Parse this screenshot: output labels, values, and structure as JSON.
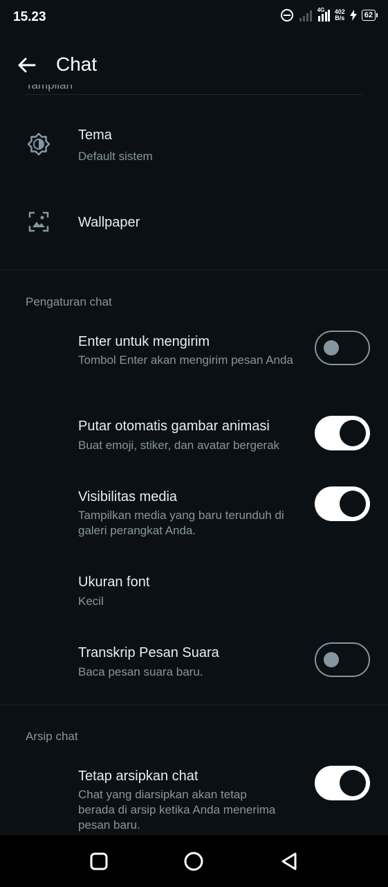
{
  "status_bar": {
    "time": "15.23",
    "net_speed_value": "402",
    "net_speed_unit": "B/s",
    "network_type": "4G",
    "battery": "62"
  },
  "app_bar": {
    "title": "Chat"
  },
  "display_section": {
    "header_clipped": "Tampilan",
    "items": [
      {
        "title": "Tema",
        "subtitle": "Default sistem",
        "icon": "brightness-icon"
      },
      {
        "title": "Wallpaper",
        "icon": "wallpaper-icon"
      }
    ]
  },
  "chat_settings": {
    "header": "Pengaturan chat",
    "items": [
      {
        "title": "Enter untuk mengirim",
        "subtitle": "Tombol Enter akan mengirim pesan Anda",
        "toggle": false
      },
      {
        "title": "Putar otomatis gambar animasi",
        "subtitle": "Buat emoji, stiker, dan avatar bergerak",
        "toggle": true
      },
      {
        "title": "Visibilitas media",
        "subtitle": "Tampilkan media yang baru terunduh di galeri perangkat Anda.",
        "toggle": true
      },
      {
        "title": "Ukuran font",
        "subtitle": "Kecil"
      },
      {
        "title": "Transkrip Pesan Suara",
        "subtitle": "Baca pesan suara baru.",
        "toggle": false
      }
    ]
  },
  "archive_section": {
    "header": "Arsip chat",
    "items": [
      {
        "title": "Tetap arsipkan chat",
        "subtitle": "Chat yang diarsipkan akan tetap berada di arsip ketika Anda menerima pesan baru.",
        "toggle": true
      }
    ]
  },
  "nav_bar": {
    "buttons": [
      "recent-apps",
      "home",
      "back"
    ]
  },
  "colors": {
    "background": "#0b1014",
    "primary_text": "#e9edef",
    "secondary_text": "#8696a0",
    "toggle_on": "#ffffff"
  }
}
